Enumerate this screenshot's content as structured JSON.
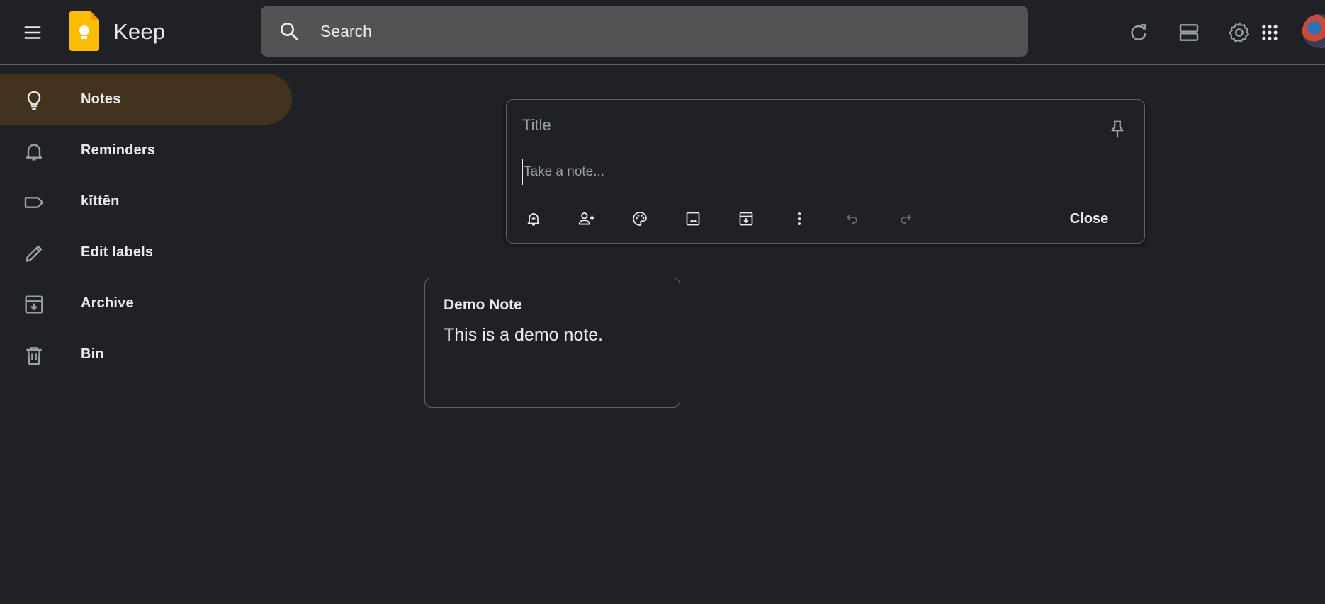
{
  "header": {
    "app_name": "Keep",
    "search_placeholder": "Search"
  },
  "sidebar": {
    "items": [
      {
        "label": "Notes",
        "icon": "lightbulb-icon",
        "active": true
      },
      {
        "label": "Reminders",
        "icon": "bell-icon",
        "active": false
      },
      {
        "label": "kĭttēn",
        "icon": "label-icon",
        "active": false
      },
      {
        "label": "Edit labels",
        "icon": "pencil-icon",
        "active": false
      },
      {
        "label": "Archive",
        "icon": "archive-icon",
        "active": false
      },
      {
        "label": "Bin",
        "icon": "trash-icon",
        "active": false
      }
    ]
  },
  "composer": {
    "title_placeholder": "Title",
    "note_placeholder": "Take a note...",
    "close_label": "Close",
    "tools": [
      "remind-me-icon",
      "collaborator-icon",
      "palette-icon",
      "image-icon",
      "archive-icon",
      "more-icon",
      "undo-icon",
      "redo-icon"
    ]
  },
  "notes": [
    {
      "title": "Demo Note",
      "body": "This is a demo note."
    }
  ],
  "colors": {
    "background": "#202124",
    "active_nav": "#41331c",
    "search_bg": "#525355",
    "border": "#5f6368",
    "logo_yellow": "#fbbc04",
    "text": "#e8eaed"
  }
}
